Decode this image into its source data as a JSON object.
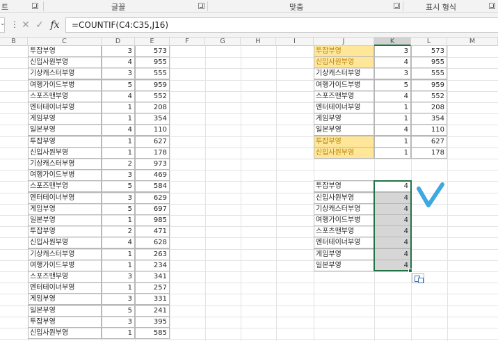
{
  "ribbon": {
    "groups": [
      {
        "label": "트"
      },
      {
        "label": "글꼴"
      },
      {
        "label": "맞춤"
      },
      {
        "label": "표시 형식"
      }
    ]
  },
  "formula_bar": {
    "formula": "=COUNTIF(C4:C35,J16)",
    "fx_label": "fx",
    "cancel_glyph": "✕",
    "enter_glyph": "✓"
  },
  "columns": [
    "B",
    "C",
    "D",
    "E",
    "F",
    "G",
    "H",
    "I",
    "J",
    "K",
    "L",
    "M"
  ],
  "left_table": [
    {
      "name": "투잡부영",
      "d": "3",
      "e": "573"
    },
    {
      "name": "신입사원부영",
      "d": "4",
      "e": "955"
    },
    {
      "name": "기상캐스터부영",
      "d": "3",
      "e": "555"
    },
    {
      "name": "여행가이드부병",
      "d": "5",
      "e": "959"
    },
    {
      "name": "스포즈맨부영",
      "d": "4",
      "e": "552"
    },
    {
      "name": "엔터테이너부영",
      "d": "1",
      "e": "208"
    },
    {
      "name": "게임부영",
      "d": "1",
      "e": "354"
    },
    {
      "name": "일본부영",
      "d": "4",
      "e": "110"
    },
    {
      "name": "투잡부영",
      "d": "1",
      "e": "627"
    },
    {
      "name": "신입사원부영",
      "d": "1",
      "e": "178"
    },
    {
      "name": "기상캐스터부영",
      "d": "2",
      "e": "973"
    },
    {
      "name": "여행가이드부병",
      "d": "3",
      "e": "469"
    },
    {
      "name": "스포즈맨부영",
      "d": "5",
      "e": "584"
    },
    {
      "name": "엔터테이너부영",
      "d": "3",
      "e": "629"
    },
    {
      "name": "게임부영",
      "d": "5",
      "e": "697"
    },
    {
      "name": "일본부영",
      "d": "1",
      "e": "985"
    },
    {
      "name": "투잡부영",
      "d": "2",
      "e": "471"
    },
    {
      "name": "신입사원부영",
      "d": "4",
      "e": "628"
    },
    {
      "name": "기상캐스터부영",
      "d": "1",
      "e": "263"
    },
    {
      "name": "여행가이드부병",
      "d": "1",
      "e": "234"
    },
    {
      "name": "스포즈맨부영",
      "d": "3",
      "e": "341"
    },
    {
      "name": "엔터테이너부영",
      "d": "1",
      "e": "257"
    },
    {
      "name": "게임부영",
      "d": "3",
      "e": "331"
    },
    {
      "name": "일본부영",
      "d": "5",
      "e": "241"
    },
    {
      "name": "투잡부영",
      "d": "3",
      "e": "395"
    },
    {
      "name": "신입사원부영",
      "d": "1",
      "e": "585"
    }
  ],
  "right_table": [
    {
      "name": "투잡부영",
      "k": "3",
      "l": "573",
      "highlight": true
    },
    {
      "name": "신입사원부영",
      "k": "4",
      "l": "955",
      "highlight": true
    },
    {
      "name": "기상캐스터부영",
      "k": "3",
      "l": "555",
      "highlight": false
    },
    {
      "name": "여행가이드부병",
      "k": "5",
      "l": "959",
      "highlight": false
    },
    {
      "name": "스포즈맨부영",
      "k": "4",
      "l": "552",
      "highlight": false
    },
    {
      "name": "엔터테이너부영",
      "k": "1",
      "l": "208",
      "highlight": false
    },
    {
      "name": "게임부영",
      "k": "1",
      "l": "354",
      "highlight": false
    },
    {
      "name": "일본부영",
      "k": "4",
      "l": "110",
      "highlight": false
    },
    {
      "name": "투잡부영",
      "k": "1",
      "l": "627",
      "highlight": true
    },
    {
      "name": "신입사원부영",
      "k": "1",
      "l": "178",
      "highlight": true
    }
  ],
  "count_table": [
    {
      "name": "투잡부영",
      "value": "4"
    },
    {
      "name": "신입사원부영",
      "value": "4"
    },
    {
      "name": "기상캐스터부영",
      "value": "4"
    },
    {
      "name": "여행가이드부병",
      "value": "4"
    },
    {
      "name": "스포츠맨부영",
      "value": "4"
    },
    {
      "name": "엔터테이너부영",
      "value": "4"
    },
    {
      "name": "게임부영",
      "value": "4"
    },
    {
      "name": "일본부영",
      "value": "4"
    }
  ],
  "colors": {
    "highlight_fill": "#ffe699",
    "highlight_text": "#b8860b",
    "selection_green": "#217346",
    "check_blue": "#3ea8e0"
  },
  "icons": {
    "check_mark": "check-mark-icon",
    "paste_options": "paste-options-icon",
    "dialog_launcher": "dialog-launcher-icon"
  }
}
